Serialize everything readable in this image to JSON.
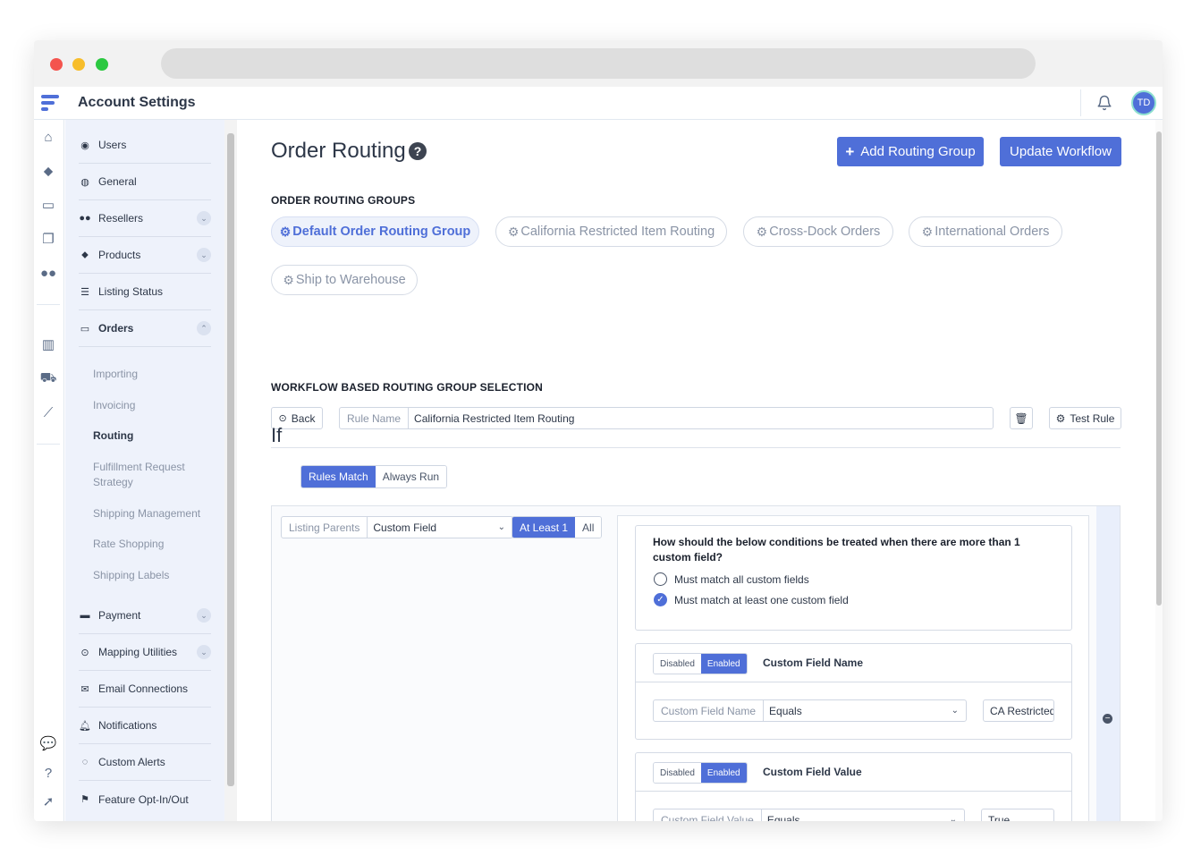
{
  "app": {
    "title": "Account Settings",
    "avatar_initials": "TD",
    "accent_color": "#4f6fd8"
  },
  "rail_icons": [
    "home-icon",
    "tag-icon",
    "inbox-icon",
    "copy-icon",
    "users-icon",
    "building-icon",
    "cart-icon",
    "chart-line-icon",
    "chat-icon",
    "question-icon",
    "rocket-icon"
  ],
  "sidebar": {
    "items": [
      {
        "label": "Users",
        "icon": "user-circle-icon"
      },
      {
        "label": "General",
        "icon": "globe-icon"
      },
      {
        "label": "Resellers",
        "icon": "users-icon"
      },
      {
        "label": "Products",
        "icon": "tag-icon"
      },
      {
        "label": "Listing Status",
        "icon": "bars-icon"
      },
      {
        "label": "Orders",
        "icon": "inbox-icon"
      }
    ],
    "order_subitems": [
      "Importing",
      "Invoicing",
      "Routing",
      "Fulfillment Request Strategy",
      "Shipping Management",
      "Rate Shopping",
      "Shipping Labels"
    ],
    "bottom_items": [
      {
        "label": "Payment",
        "icon": "credit-card-icon"
      },
      {
        "label": "Mapping Utilities",
        "icon": "crosshair-icon"
      },
      {
        "label": "Email Connections",
        "icon": "envelope-icon"
      },
      {
        "label": "Notifications",
        "icon": "bell-icon"
      },
      {
        "label": "Custom Alerts",
        "icon": "comment-icon"
      },
      {
        "label": "Feature Opt-In/Out",
        "icon": "flag-icon"
      }
    ]
  },
  "main": {
    "title": "Order Routing",
    "add_button": "Add Routing Group",
    "update_button": "Update Workflow",
    "groups_label": "ORDER ROUTING GROUPS",
    "groups": [
      "Default Order Routing Group",
      "California Restricted Item Routing",
      "Cross-Dock Orders",
      "International Orders",
      "Ship to Warehouse"
    ],
    "workflow_label": "WORKFLOW BASED ROUTING GROUP SELECTION",
    "back_button": "Back",
    "rule_name_caption": "Rule Name",
    "rule_name_value": "California Restricted Item Routing",
    "test_rule_button": "Test Rule",
    "if_label": "If",
    "match_options": [
      "Rules Match",
      "Always Run"
    ],
    "left_filter": {
      "caption": "Listing Parents",
      "value": "Custom Field",
      "modes": [
        "At Least 1",
        "All"
      ]
    },
    "question": "How should the below conditions be treated when there are more than 1 custom field?",
    "radio_options": [
      "Must match all custom fields",
      "Must match at least one custom field"
    ],
    "toggle_options": [
      "Disabled",
      "Enabled"
    ],
    "cards": [
      {
        "title": "Custom Field Name",
        "caption": "Custom Field Name",
        "operator": "Equals",
        "value": "CA Restricted"
      },
      {
        "title": "Custom Field Value",
        "caption": "Custom Field Value",
        "operator": "Equals",
        "value": "True"
      }
    ]
  }
}
